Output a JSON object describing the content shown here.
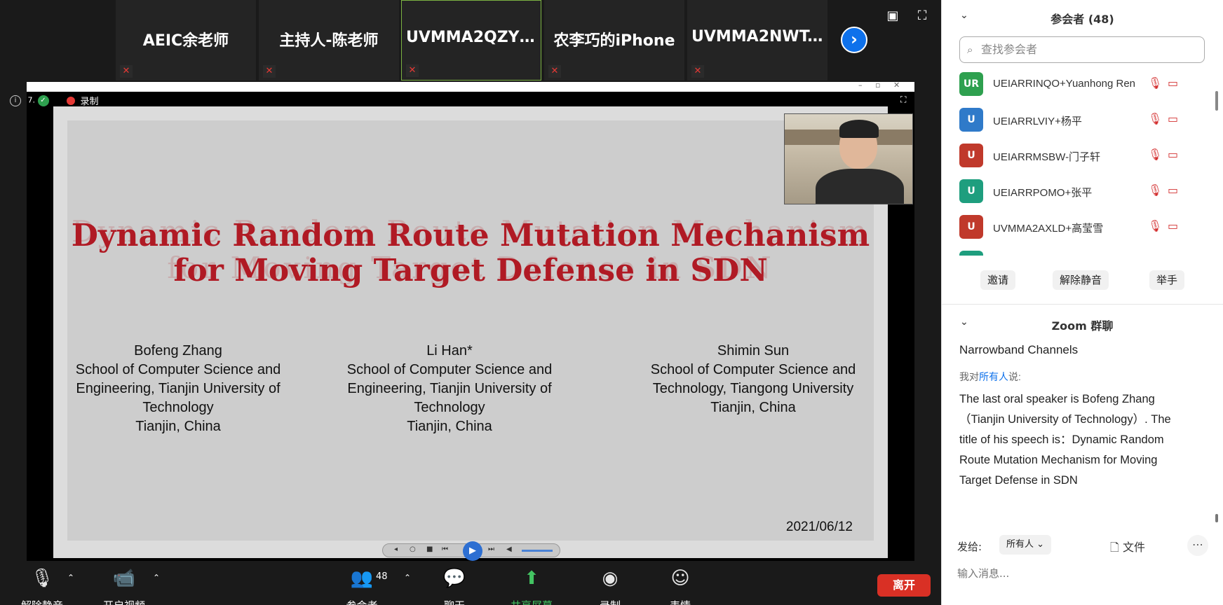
{
  "thumbnails": [
    {
      "name": "AEIC余老师"
    },
    {
      "name": "主持人-陈老师"
    },
    {
      "name": "UVMMA2QZYL..."
    },
    {
      "name": "农李巧的iPhone"
    },
    {
      "name": "UVMMA2NWT..."
    }
  ],
  "share": {
    "info_label": "7.",
    "recording_label": "录制"
  },
  "slide": {
    "title_line1": "Dynamic Random Route Mutation Mechanism",
    "title_line2": "for Moving Target Defense in SDN",
    "ghost_line1": "Dynamic Random Route Mutation Mechanism",
    "ghost_line2": "for Moving Target Defense in SDN",
    "authors": [
      {
        "name": "Bofeng Zhang",
        "affil": "School of Computer Science and Engineering, Tianjin University of Technology",
        "place": "Tianjin, China"
      },
      {
        "name": "Li Han*",
        "affil": "School of Computer Science and Engineering, Tianjin University of Technology",
        "place": "Tianjin, China"
      },
      {
        "name": "Shimin Sun",
        "affil": "School of Computer Science and Technology, Tiangong University",
        "place": "Tianjin, China"
      }
    ],
    "date": "2021/06/12"
  },
  "toolbar": {
    "unmute": "解除静音",
    "start_video": "开启视频",
    "participants": "参会者",
    "participants_count": "48",
    "chat": "聊天",
    "share_screen": "共享屏幕",
    "record": "录制",
    "reactions": "表情",
    "leave": "离开"
  },
  "panel": {
    "title": "参会者 (48)",
    "search_placeholder": "查找参会者",
    "participants": [
      {
        "initials": "UR",
        "name": "UEIARRINQO+Yuanhong Ren",
        "color": "#2ea04f"
      },
      {
        "initials": "U",
        "name": "UEIARRLVIY+杨平",
        "color": "#2f7ac9"
      },
      {
        "initials": "U",
        "name": "UEIARRMSBW-门子轩",
        "color": "#c0392b"
      },
      {
        "initials": "U",
        "name": "UEIARRPOMO+张平",
        "color": "#1e9e7e"
      },
      {
        "initials": "U",
        "name": "UVMMA2AXLD+高莹雪",
        "color": "#c0392b"
      }
    ],
    "buttons": {
      "invite": "邀请",
      "unmute_all": "解除静音",
      "raise_hand": "举手"
    }
  },
  "chat": {
    "title": "Zoom 群聊",
    "prev_line": "Narrowband Channels",
    "meta_prefix": "我对",
    "meta_to": "所有人",
    "meta_suffix": "说:",
    "message": "The last oral speaker is Bofeng Zhang（Tianjin University of Technology）. The title of his speech is：Dynamic Random Route Mutation Mechanism for Moving Target Defense in SDN",
    "send_to_label": "发给:",
    "send_to_value": "所有人",
    "file_label": "文件",
    "input_placeholder": "输入消息..."
  }
}
